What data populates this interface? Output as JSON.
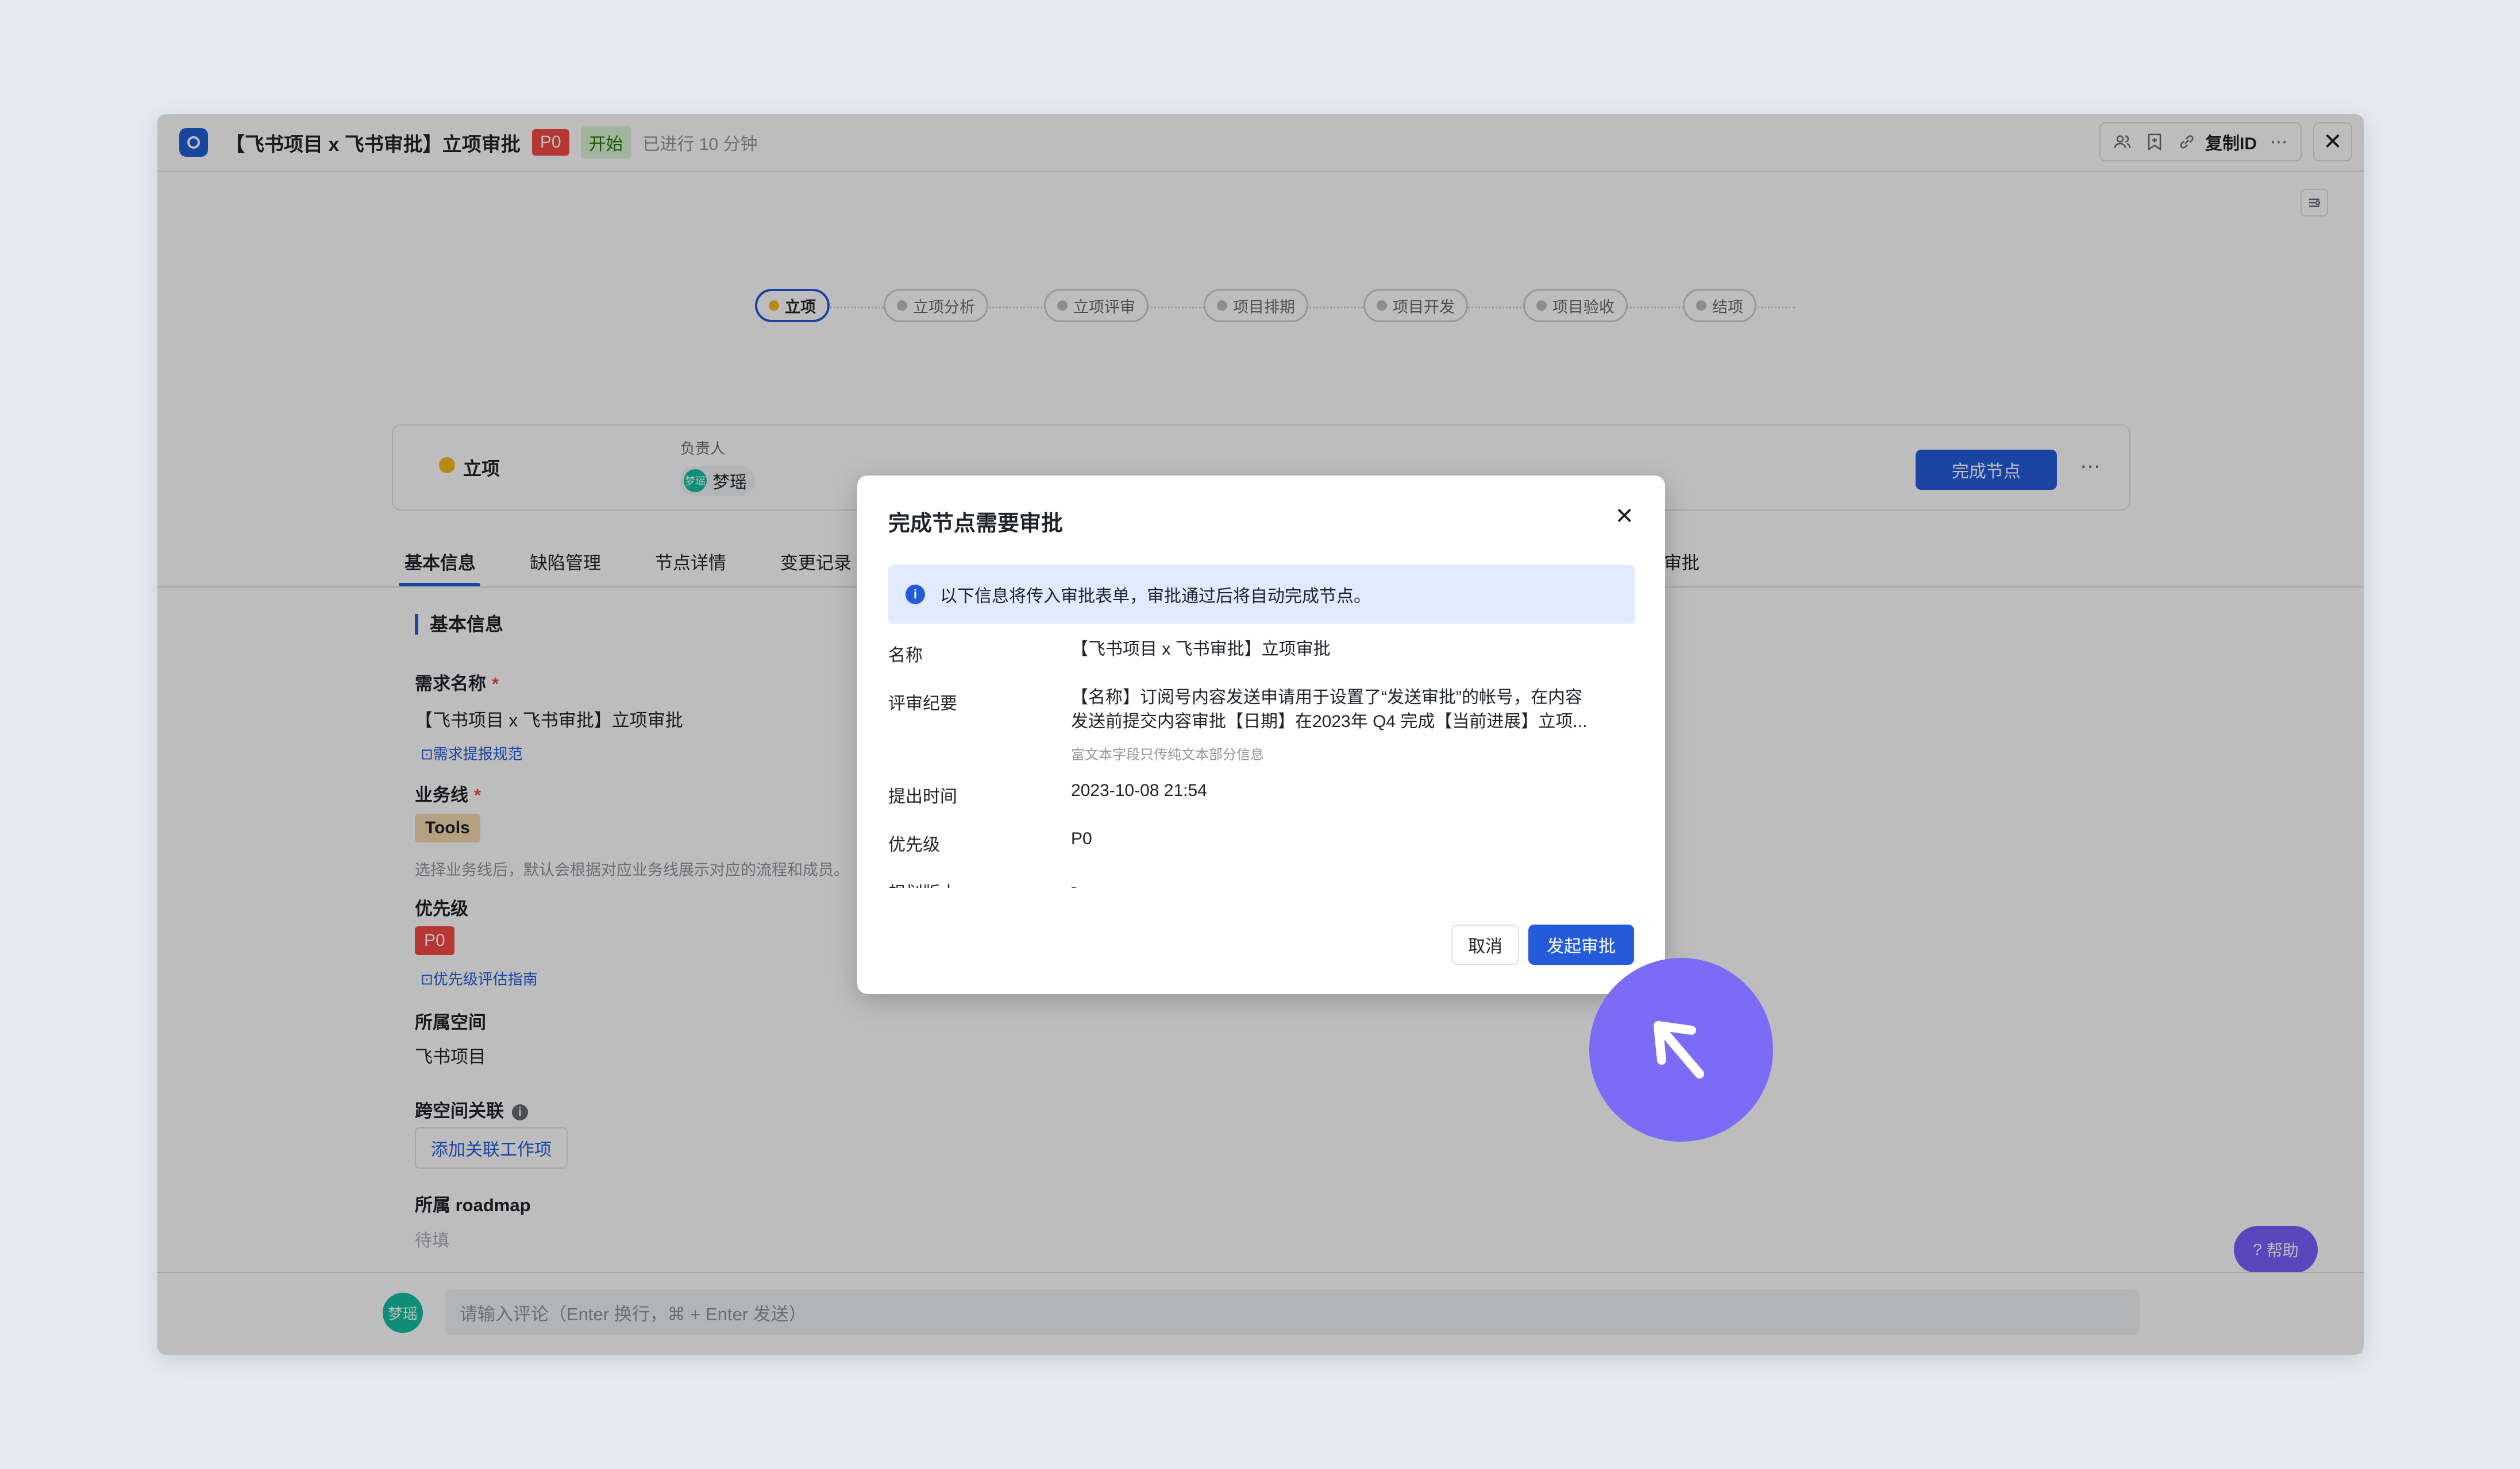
{
  "titlebar": {
    "title": "【飞书项目 x 飞书审批】立项审批",
    "priority_badge": "P0",
    "status_badge": "开始",
    "elapsed": "已进行 10 分钟",
    "copy_id": "复制ID"
  },
  "workflow": {
    "nodes": [
      "立项",
      "立项分析",
      "立项评审",
      "项目排期",
      "项目开发",
      "项目验收",
      "结项"
    ],
    "active_index": 0
  },
  "node_card": {
    "title": "立项",
    "owner_label": "负责人",
    "owner_avatar": "梦瑶",
    "owner_name": "梦瑶",
    "complete_button": "完成节点"
  },
  "tabs": [
    {
      "label": "基本信息",
      "active": true
    },
    {
      "label": "缺陷管理"
    },
    {
      "label": "节点详情"
    },
    {
      "label": "变更记录"
    },
    {
      "label": "审批"
    }
  ],
  "form": {
    "section_title": "基本信息",
    "name_label": "需求名称",
    "name_required": "*",
    "name_value": "【飞书项目 x 飞书审批】立项审批",
    "name_link": "需求提报规范",
    "business_label": "业务线",
    "business_required": "*",
    "business_tag": "Tools",
    "business_hint": "选择业务线后，默认会根据对应业务线展示对应的流程和成员。",
    "priority_label": "优先级",
    "priority_tag": "P0",
    "priority_link": "优先级评估指南",
    "space_label": "所属空间",
    "space_value": "飞书项目",
    "cross_label": "跨空间关联",
    "cross_button": "添加关联工作项",
    "roadmap_label": "所属 roadmap",
    "roadmap_placeholder": "待填"
  },
  "comment": {
    "avatar": "梦瑶",
    "placeholder": "请输入评论（Enter 换行，⌘ + Enter 发送）"
  },
  "help": {
    "label": "帮助"
  },
  "modal": {
    "title": "完成节点需要审批",
    "info": "以下信息将传入审批表单，审批通过后将自动完成节点。",
    "rows": [
      {
        "label": "名称",
        "value": "【飞书项目 x 飞书审批】立项审批"
      },
      {
        "label": "评审纪要",
        "value_line1": "【名称】订阅号内容发送申请用于设置了“发送审批”的帐号，在内容",
        "value_line2": "发送前提交内容审批【日期】在2023年 Q4 完成【当前进展】立项...",
        "hint": "富文本字段只传纯文本部分信息"
      },
      {
        "label": "提出时间",
        "value": "2023-10-08 21:54"
      },
      {
        "label": "优先级",
        "value": "P0"
      },
      {
        "label": "规划版本",
        "value": "-"
      }
    ],
    "cancel": "取消",
    "submit": "发起审批"
  },
  "colors": {
    "primary": "#245bdb",
    "danger": "#f54a45",
    "cursor": "#7b6cf6"
  }
}
